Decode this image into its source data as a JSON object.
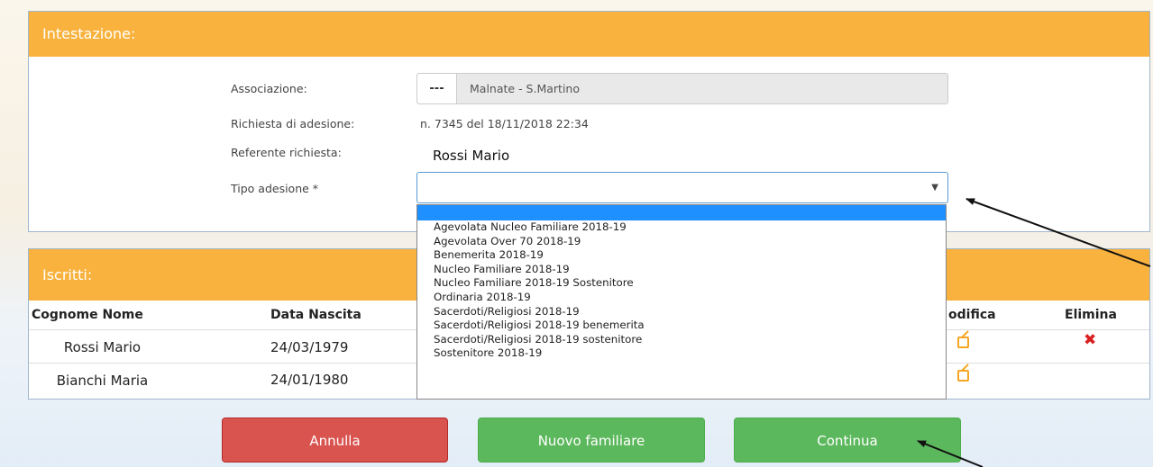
{
  "header": {
    "title": "Intestazione:"
  },
  "form": {
    "association_label": "Associazione:",
    "association_button": "---",
    "association_value": "Malnate - S.Martino",
    "request_label": "Richiesta di adesione:",
    "request_value": "n. 7345 del 18/11/2018 22:34",
    "referent_label": "Referente richiesta:",
    "referent_value": "Rossi Mario",
    "type_label": "Tipo adesione *",
    "type_value": ""
  },
  "dropdown": {
    "options": [
      "Agevolata Nucleo Familiare 2018-19",
      "Agevolata Over 70 2018-19",
      "Benemerita 2018-19",
      "Nucleo Familiare 2018-19",
      "Nucleo Familiare 2018-19 Sostenitore",
      "Ordinaria 2018-19",
      "Sacerdoti/Religiosi 2018-19",
      "Sacerdoti/Religiosi 2018-19 benemerita",
      "Sacerdoti/Religiosi 2018-19 sostenitore",
      "Sostenitore 2018-19"
    ]
  },
  "subscribers": {
    "title": "Iscritti:",
    "columns": {
      "name": "Cognome Nome",
      "birth": "Data Nascita",
      "edit": "odifica",
      "delete": "Elimina"
    },
    "rows": [
      {
        "name": "Rossi Mario",
        "birth": "24/03/1979"
      },
      {
        "name": "Bianchi Maria",
        "birth": "24/01/1980"
      }
    ]
  },
  "buttons": {
    "cancel": "Annulla",
    "new_member": "Nuovo familiare",
    "continue": "Continua"
  },
  "colors": {
    "header": "#f8b23d",
    "cancel": "#d9534f",
    "success": "#5cb85c",
    "edit_icon": "#f5a623",
    "delete_icon": "#d9201f"
  }
}
